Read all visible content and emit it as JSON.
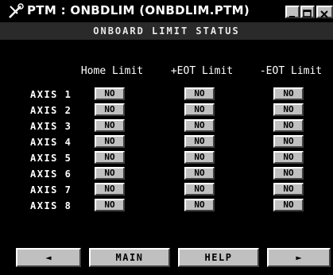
{
  "window": {
    "title": "PTM : ONBDLIM (ONBDLIM.PTM)",
    "subtitle": "ONBOARD LIMIT STATUS"
  },
  "columns": {
    "home": "Home Limit",
    "peot": "+EOT Limit",
    "meot": "-EOT Limit"
  },
  "axes": [
    {
      "label": "AXIS 1",
      "home": "NO",
      "peot": "NO",
      "meot": "NO"
    },
    {
      "label": "AXIS 2",
      "home": "NO",
      "peot": "NO",
      "meot": "NO"
    },
    {
      "label": "AXIS 3",
      "home": "NO",
      "peot": "NO",
      "meot": "NO"
    },
    {
      "label": "AXIS 4",
      "home": "NO",
      "peot": "NO",
      "meot": "NO"
    },
    {
      "label": "AXIS 5",
      "home": "NO",
      "peot": "NO",
      "meot": "NO"
    },
    {
      "label": "AXIS 6",
      "home": "NO",
      "peot": "NO",
      "meot": "NO"
    },
    {
      "label": "AXIS 7",
      "home": "NO",
      "peot": "NO",
      "meot": "NO"
    },
    {
      "label": "AXIS 8",
      "home": "NO",
      "peot": "NO",
      "meot": "NO"
    }
  ],
  "nav": {
    "prev": "◄",
    "main": "MAIN",
    "help": "HELP",
    "next": "►"
  },
  "icons": {
    "title": "wrench-icon"
  },
  "colors": {
    "background": "#000000",
    "button_face": "#c0c0c0",
    "subtitle_bar": "#2a2a2a",
    "text": "#ffffff"
  }
}
